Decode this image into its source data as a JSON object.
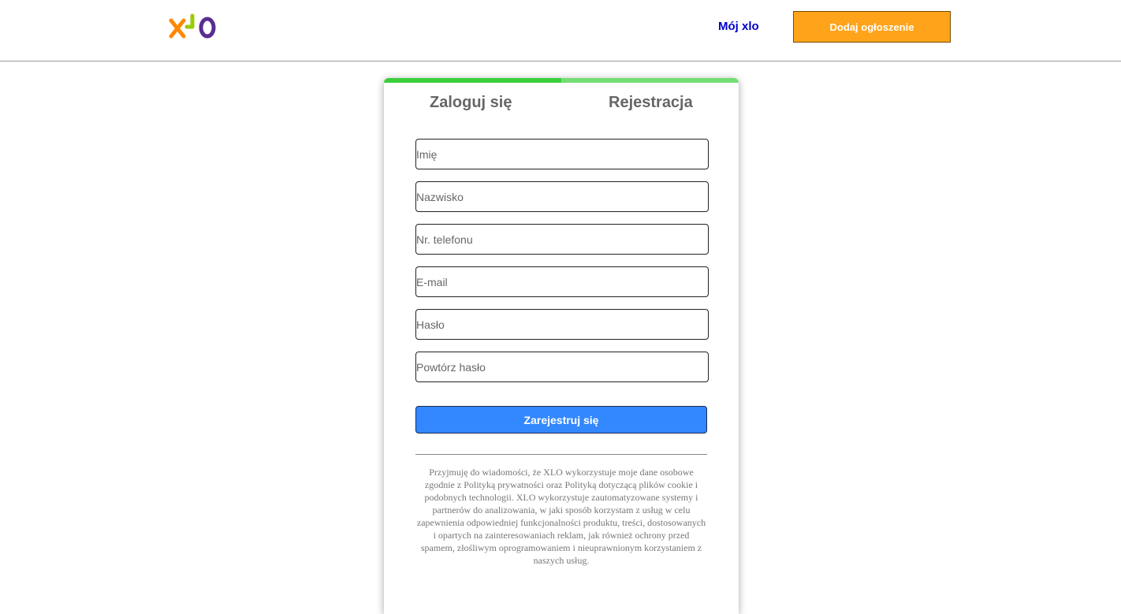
{
  "header": {
    "logo_text": "XLO",
    "logo_colors": [
      "#ff8800",
      "#99cc00",
      "#5a2d91"
    ],
    "my_account_link": "Mój xlo",
    "add_listing_button": "Dodaj ogłoszenie"
  },
  "auth": {
    "tabs": [
      {
        "label": "Zaloguj się",
        "active": false
      },
      {
        "label": "Rejestracja",
        "active": true
      }
    ],
    "fields": [
      {
        "placeholder": "Imię",
        "value": ""
      },
      {
        "placeholder": "Nazwisko",
        "value": ""
      },
      {
        "placeholder": "Nr. telefonu",
        "value": ""
      },
      {
        "placeholder": "E-mail",
        "value": ""
      },
      {
        "placeholder": "Hasło",
        "value": ""
      },
      {
        "placeholder": "Powtórz hasło",
        "value": ""
      }
    ],
    "submit_label": "Zarejestruj się",
    "consent_text": "Przyjmuję do wiadomości, że XLO wykorzystuje moje dane osobowe zgodnie z Polityką prywatności oraz Polityką dotyczącą plików cookie i podobnych technologii. XLO wykorzystuje zautomatyzowane systemy i partnerów do analizowania, w jaki sposób korzystam z usług w celu zapewnienia odpowiedniej funkcjonalności produktu, treści, dostosowanych i opartych na zainteresowaniach reklam, jak również ochrony przed spamem, złośliwym oprogramowaniem i nieuprawnionym korzystaniem z naszych usług."
  },
  "colors": {
    "accent_orange": "#ffa31a",
    "tab_active": "#3ccf3c",
    "tab_inactive": "#74dd74",
    "submit_blue": "#3388ff",
    "link_blue": "#0000cc"
  }
}
